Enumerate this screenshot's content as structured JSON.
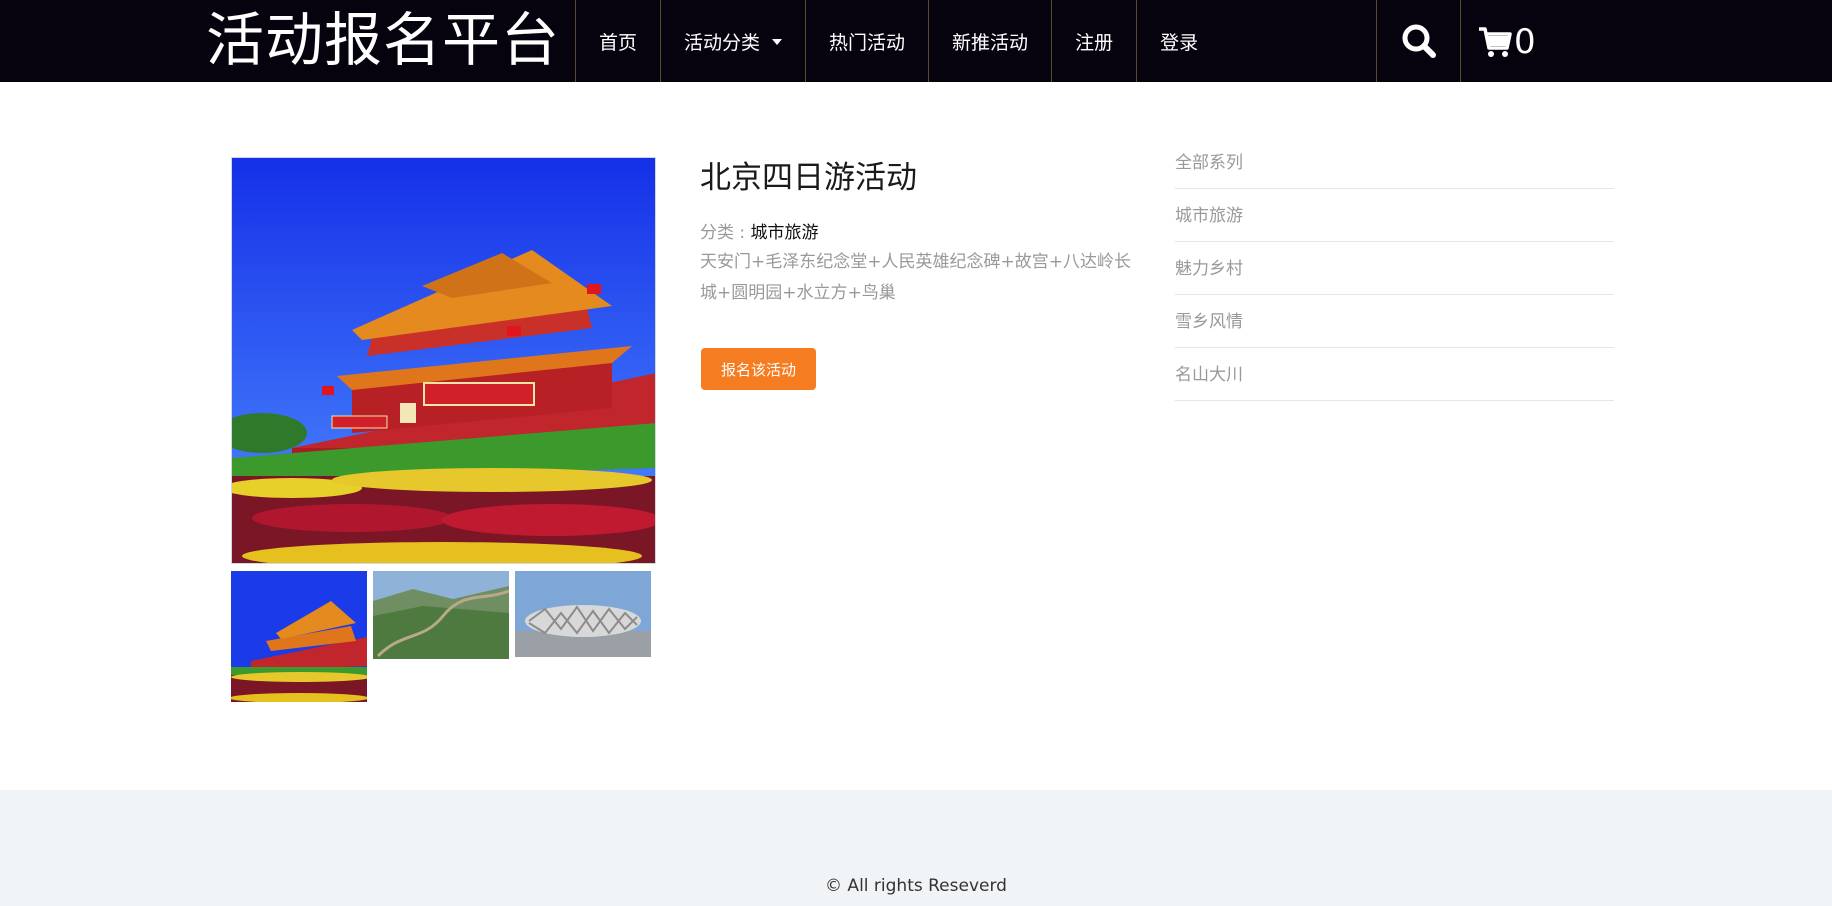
{
  "header": {
    "brand": "活动报名平台",
    "nav": [
      {
        "label": "首页"
      },
      {
        "label": "活动分类",
        "has_dropdown": true
      },
      {
        "label": "热门活动"
      },
      {
        "label": "新推活动"
      },
      {
        "label": "注册"
      },
      {
        "label": "登录"
      }
    ],
    "search_icon": "search-icon",
    "cart_icon": "cart-icon",
    "cart_count": "0"
  },
  "activity": {
    "title": "北京四日游活动",
    "category_label": "分类 :",
    "category_value": "城市旅游",
    "description": "天安门+毛泽东纪念堂+人民英雄纪念碑+故宫+八达岭长城+圆明园+水立方+鸟巢",
    "signup_button": "报名该活动",
    "images": [
      "tiananmen",
      "great-wall",
      "birds-nest"
    ]
  },
  "sidebar": {
    "items": [
      {
        "label": "全部系列"
      },
      {
        "label": "城市旅游"
      },
      {
        "label": "魅力乡村"
      },
      {
        "label": "雪乡风情"
      },
      {
        "label": "名山大川"
      }
    ]
  },
  "footer": {
    "copyright": "© All rights Reseverd"
  },
  "colors": {
    "header_bg": "#07030e",
    "accent": "#f57c20",
    "footer_bg": "#f1f4f6"
  }
}
